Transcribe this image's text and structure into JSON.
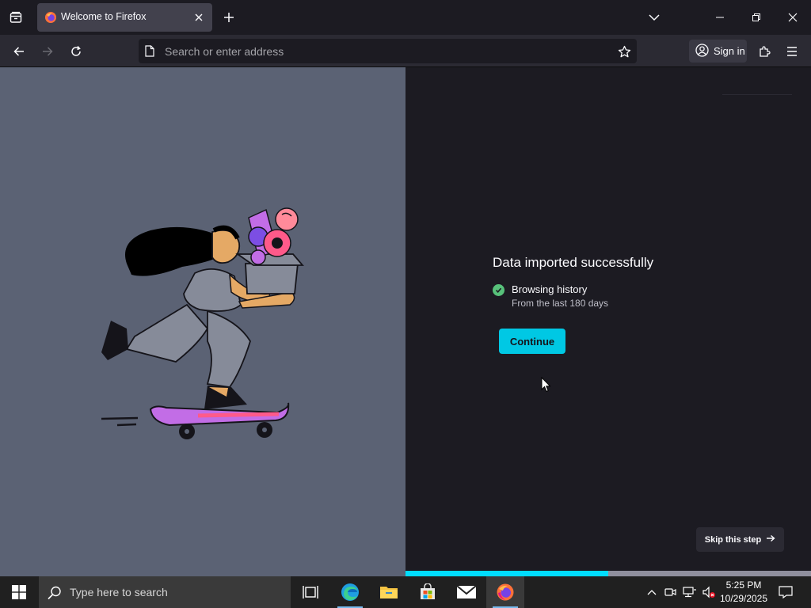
{
  "browser": {
    "tab": {
      "title": "Welcome to Firefox"
    },
    "urlbar": {
      "placeholder": "Search or enter address"
    },
    "account": {
      "label": "Sign in"
    }
  },
  "onboarding": {
    "heading": "Data imported successfully",
    "imported_items": [
      {
        "label": "Browsing history",
        "detail": "From the last 180 days"
      }
    ],
    "primary_button": "Continue",
    "skip_button": "Skip this step",
    "progress_fraction": 0.5
  },
  "taskbar": {
    "search_placeholder": "Type here to search",
    "time": "5:25 PM",
    "date": "10/29/2025",
    "pinned": [
      "task-view-icon",
      "edge-icon",
      "file-explorer-icon",
      "store-icon",
      "mail-icon",
      "firefox-icon"
    ]
  },
  "colors": {
    "accent": "#00ddff",
    "illustration_bg": "#5b6274",
    "page_bg": "#1c1b22",
    "check": "#57c17a"
  }
}
